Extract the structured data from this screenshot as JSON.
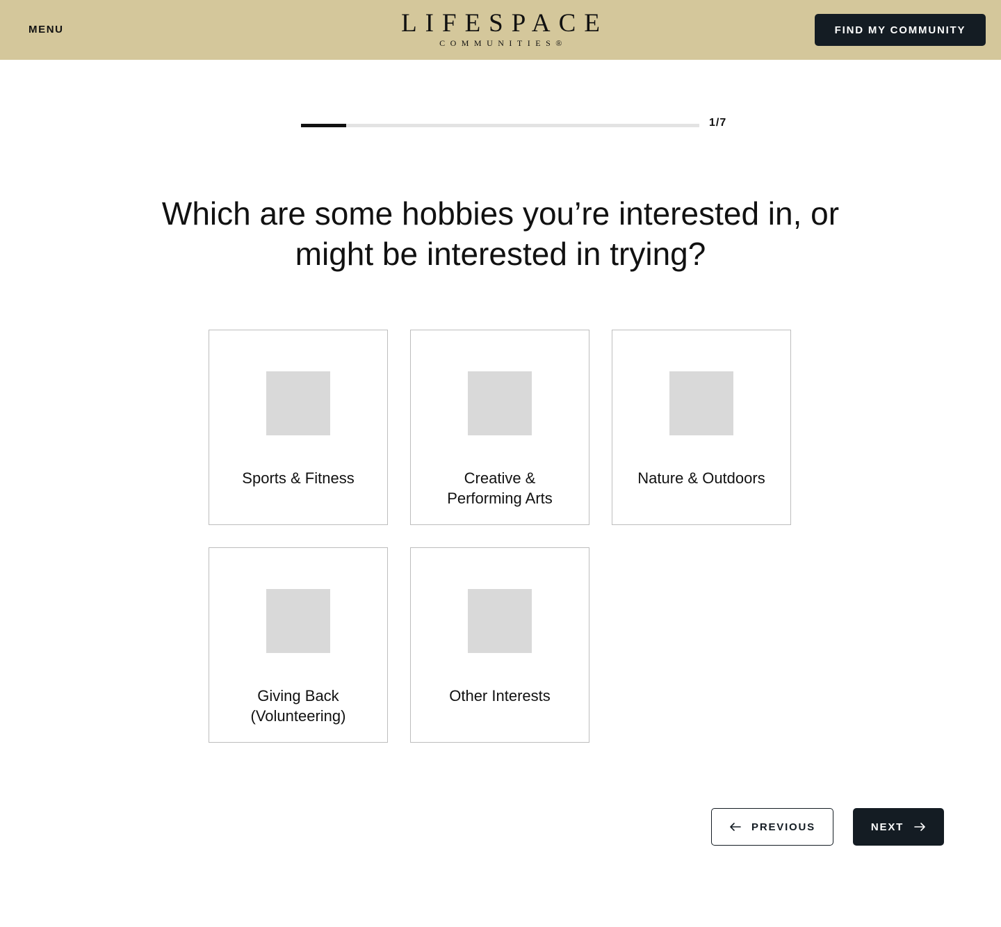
{
  "header": {
    "menu_label": "MENU",
    "logo_main": "LIFESPACE",
    "logo_sub": "COMMUNITIES®",
    "cta_label": "FIND MY COMMUNITY",
    "background_color": "#d4c79b",
    "cta_color": "#141c23"
  },
  "progress": {
    "label": "1/7",
    "current_step": 1,
    "total_steps": 7,
    "fraction": 0.1143
  },
  "question": {
    "text": "Which are some hobbies you’re interested in, or might be interested in trying?"
  },
  "options": [
    {
      "label": "Sports & Fitness",
      "icon": "image-placeholder"
    },
    {
      "label": "Creative & Performing Arts",
      "icon": "image-placeholder"
    },
    {
      "label": "Nature & Outdoors",
      "icon": "image-placeholder"
    },
    {
      "label": "Giving Back (Volunteering)",
      "icon": "image-placeholder"
    },
    {
      "label": "Other Interests",
      "icon": "image-placeholder"
    }
  ],
  "navigation": {
    "previous_label": "PREVIOUS",
    "previous_icon": "arrow-left-icon",
    "next_label": "NEXT",
    "next_icon": "arrow-right-icon"
  }
}
